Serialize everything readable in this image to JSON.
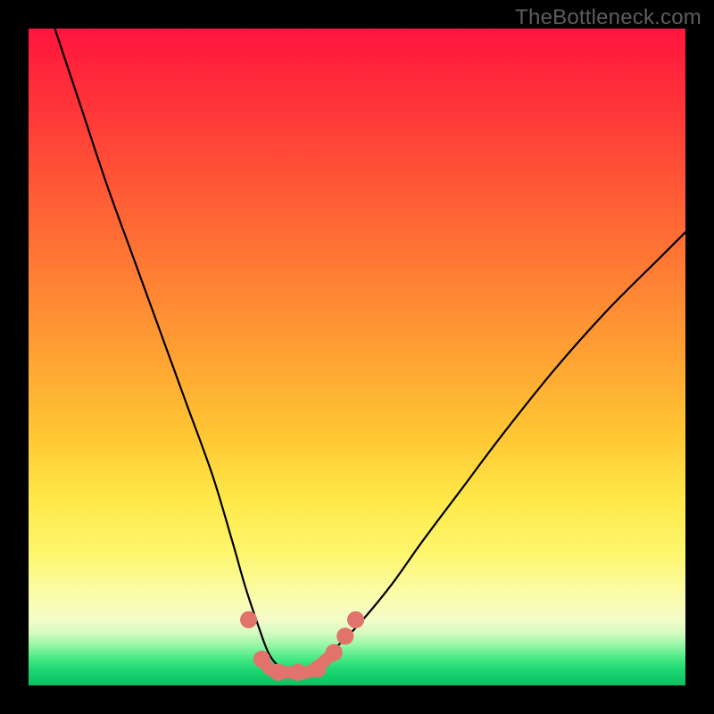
{
  "watermark": "TheBottleneck.com",
  "chart_data": {
    "type": "line",
    "title": "",
    "xlabel": "",
    "ylabel": "",
    "xlim": [
      0,
      100
    ],
    "ylim": [
      0,
      100
    ],
    "grid": false,
    "legend": false,
    "series": [
      {
        "name": "bottleneck-curve",
        "color": "#000000",
        "x": [
          4,
          8,
          12,
          16,
          20,
          24,
          28,
          31,
          33,
          35,
          36.5,
          38,
          40,
          42,
          44,
          46,
          50,
          55,
          60,
          66,
          72,
          80,
          88,
          96,
          100
        ],
        "y": [
          100,
          88,
          76,
          65,
          54,
          43,
          32,
          22,
          15,
          9,
          5,
          3,
          2,
          2,
          3,
          5,
          9,
          15,
          22,
          30,
          38,
          48,
          57,
          65,
          69
        ]
      }
    ],
    "markers": {
      "name": "highlighted-points",
      "color": "#e2736c",
      "radius_pct": 1.3,
      "points": [
        {
          "x": 33.5,
          "y": 10
        },
        {
          "x": 35.5,
          "y": 4
        },
        {
          "x": 38,
          "y": 2
        },
        {
          "x": 41,
          "y": 2
        },
        {
          "x": 44,
          "y": 2.5
        },
        {
          "x": 46.5,
          "y": 5
        },
        {
          "x": 48.2,
          "y": 7.5
        },
        {
          "x": 49.8,
          "y": 10
        }
      ],
      "connector": [
        {
          "x": 35.5,
          "y": 4
        },
        {
          "x": 37,
          "y": 2.3
        },
        {
          "x": 40,
          "y": 2
        },
        {
          "x": 43,
          "y": 2.2
        },
        {
          "x": 46.5,
          "y": 5
        }
      ]
    },
    "background_gradient": {
      "direction": "vertical",
      "stops": [
        {
          "pos": 0.0,
          "color": "#ff153f"
        },
        {
          "pos": 0.5,
          "color": "#ffa233"
        },
        {
          "pos": 0.8,
          "color": "#fdf66e"
        },
        {
          "pos": 0.92,
          "color": "#d6fbc3"
        },
        {
          "pos": 1.0,
          "color": "#0fbd60"
        }
      ]
    }
  }
}
